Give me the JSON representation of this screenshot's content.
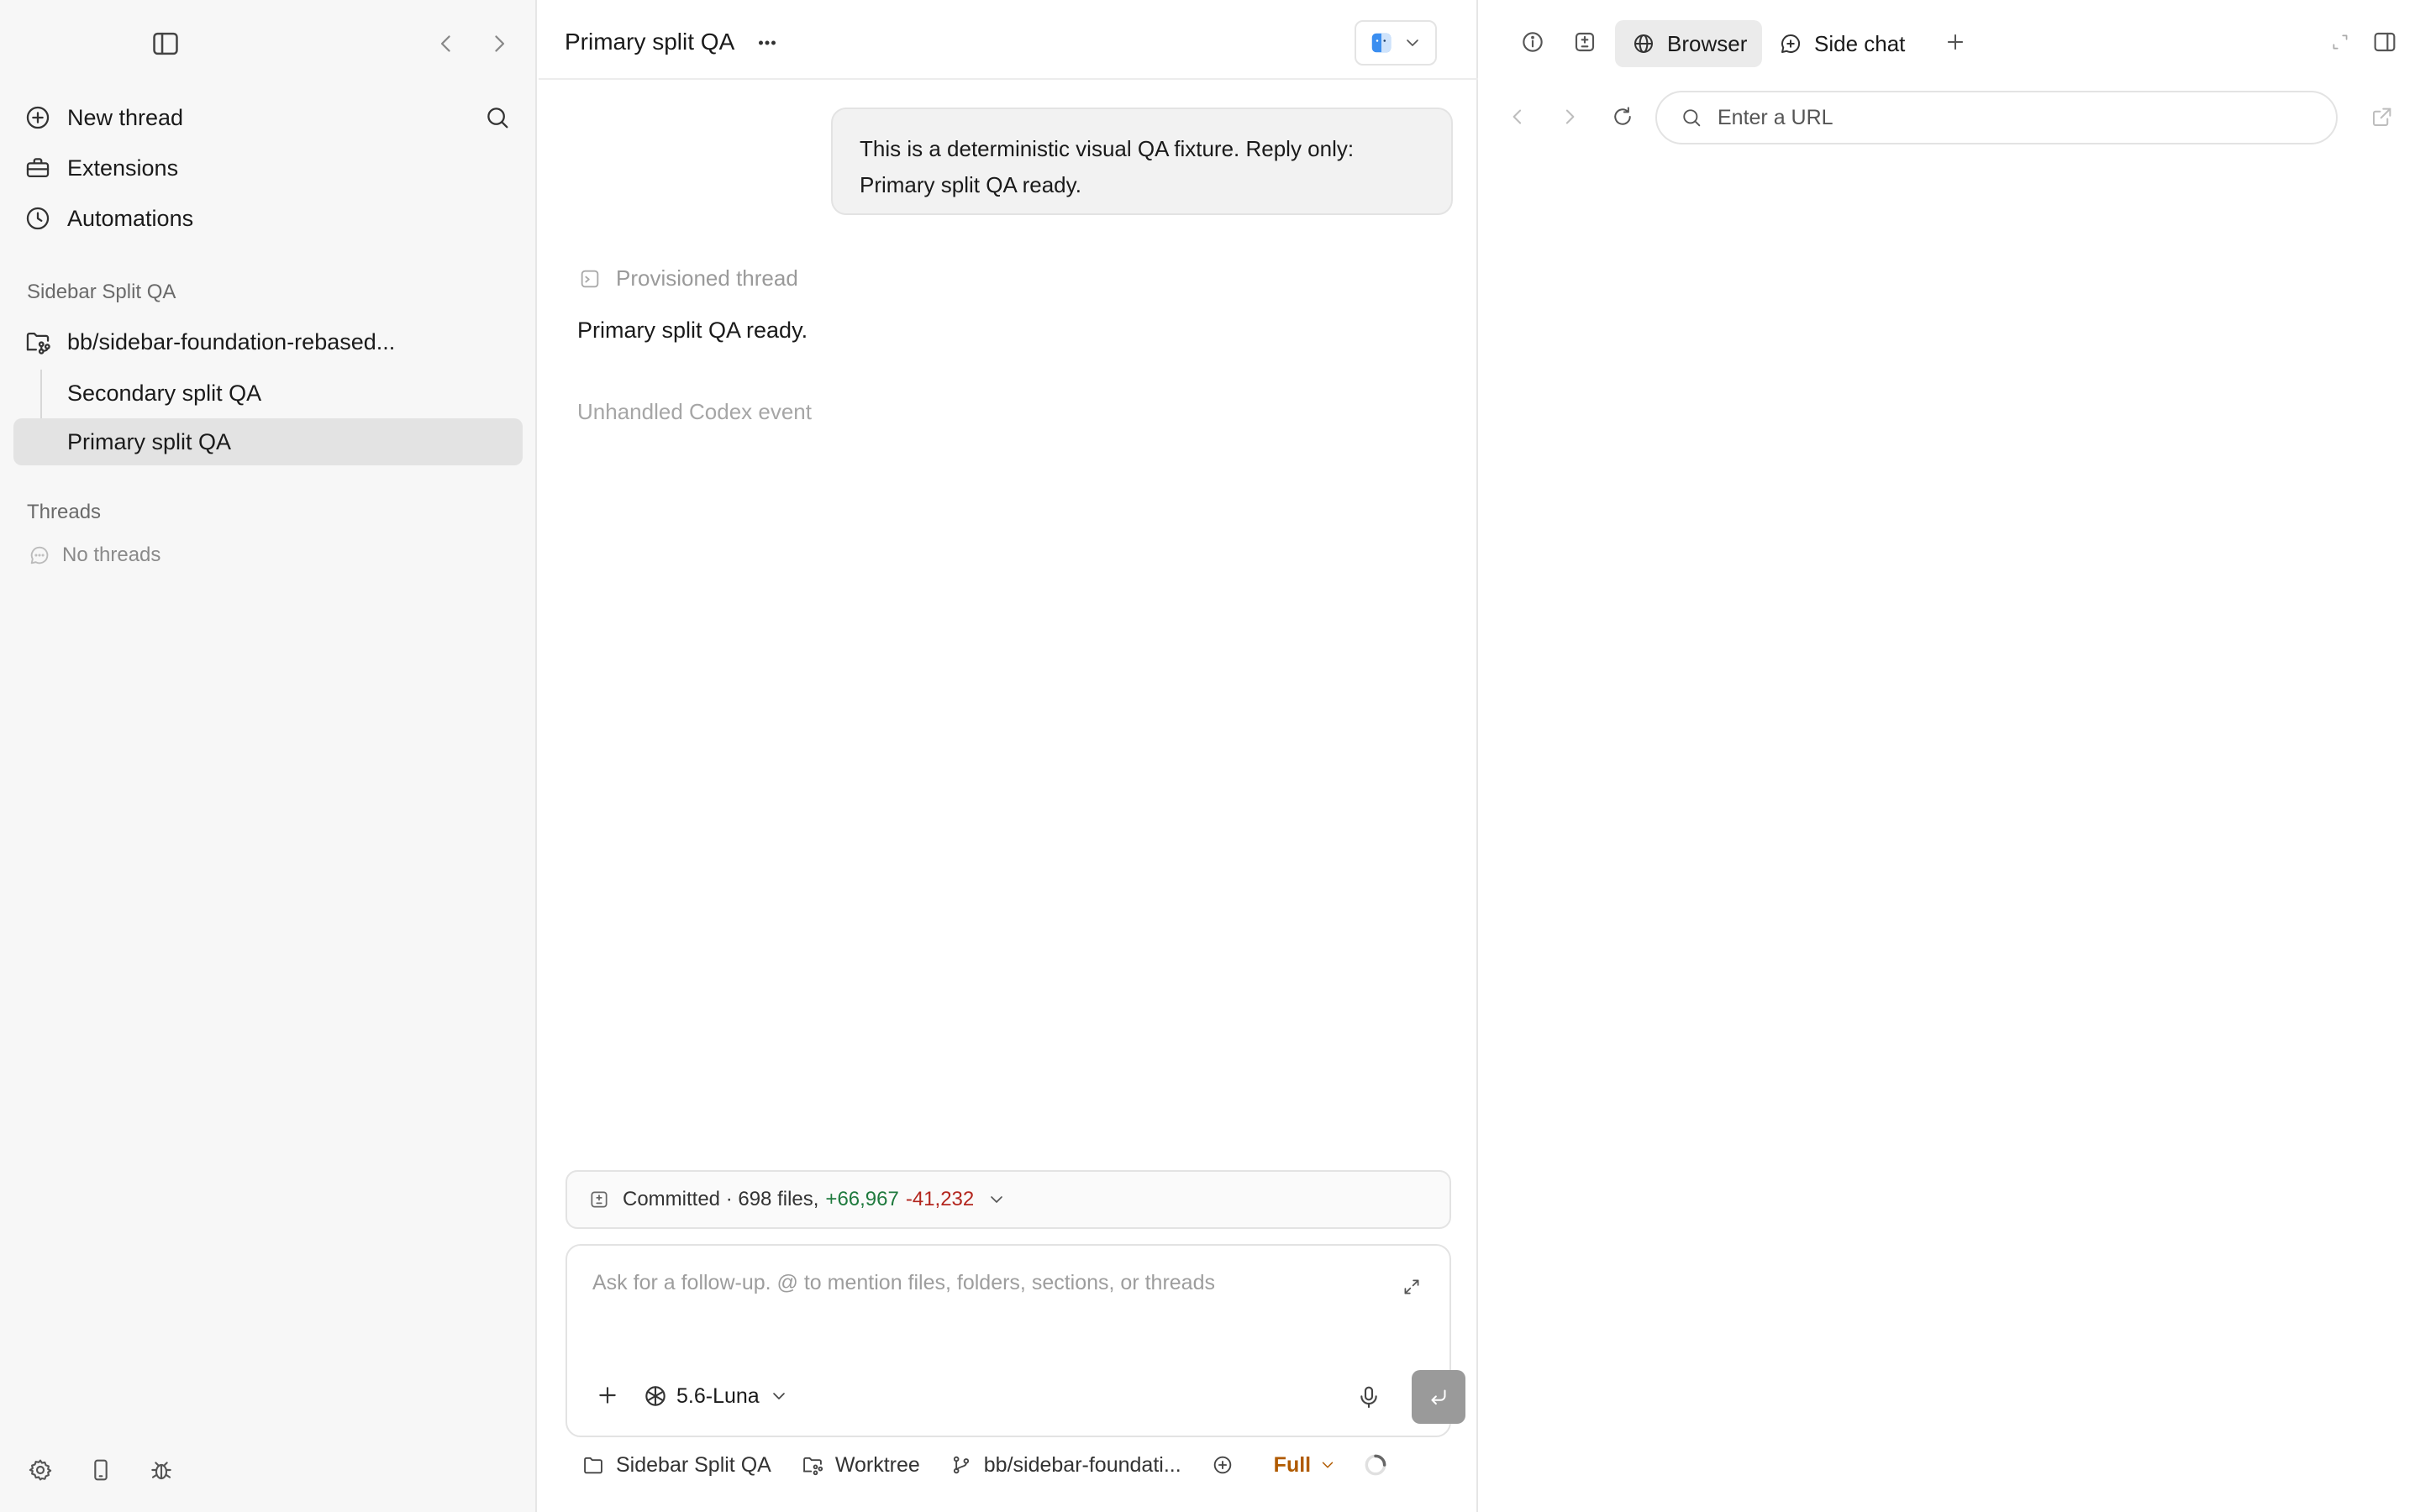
{
  "sidebar": {
    "nav": [
      {
        "label": "New thread",
        "icon": "plus-circle-icon"
      },
      {
        "label": "Extensions",
        "icon": "toolbox-icon"
      },
      {
        "label": "Automations",
        "icon": "clock-icon"
      }
    ],
    "project_section": "Sidebar Split QA",
    "worktree_label": "bb/sidebar-foundation-rebased...",
    "threads": [
      {
        "label": "Secondary split QA",
        "active": false
      },
      {
        "label": "Primary split QA",
        "active": true
      }
    ],
    "threads_section": "Threads",
    "no_threads": "No threads"
  },
  "main": {
    "title": "Primary split QA",
    "user_message": "This is a deterministic visual QA fixture. Reply only: Primary split QA ready.",
    "provisioned_label": "Provisioned thread",
    "reply": "Primary split QA ready.",
    "unhandled": "Unhandled Codex event",
    "commit": {
      "prefix": "Committed · 698 files,",
      "additions": "+66,967",
      "deletions": "-41,232"
    },
    "composer": {
      "placeholder": "Ask for a follow-up. @ to mention files, folders, sections, or threads",
      "model": "5.6-Luna"
    },
    "footer": {
      "project": "Sidebar Split QA",
      "worktree": "Worktree",
      "branch": "bb/sidebar-foundati...",
      "access": "Full"
    }
  },
  "panel": {
    "tabs": [
      {
        "label": "Browser",
        "active": true
      },
      {
        "label": "Side chat",
        "active": false
      }
    ],
    "url_placeholder": "Enter a URL"
  },
  "colors": {
    "additions": "#1f7a3e",
    "deletions": "#b3261e",
    "access": "#b05a00",
    "active_row": "#e3e3e3"
  }
}
